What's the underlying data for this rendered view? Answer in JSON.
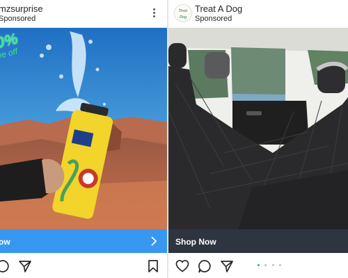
{
  "left_post": {
    "username": "mzsurprise",
    "sponsored_label": "Sponsored",
    "cta_label": "ow",
    "promo_text": "0%",
    "promo_subtext": "ve off",
    "colors": {
      "cta": "#3897f0",
      "sky": "#2f7ec9",
      "ground": "#b85a3a",
      "bottle": "#f2d42a"
    },
    "icons": [
      "more-vert-icon",
      "chevron-right-icon",
      "comment-icon",
      "share-icon",
      "bookmark-icon"
    ]
  },
  "right_post": {
    "username": "Treat A Dog",
    "sponsored_label": "Sponsored",
    "cta_label": "Shop Now",
    "avatar_text_line1": "Treat",
    "avatar_text_line2": "Dog",
    "colors": {
      "cta": "#2e3440",
      "seat_cover": "#2a2a2c",
      "active_dot": "#3897f0"
    },
    "carousel": {
      "count": 4,
      "active_index": 0
    },
    "icons": [
      "heart-icon",
      "comment-icon",
      "share-icon"
    ]
  }
}
